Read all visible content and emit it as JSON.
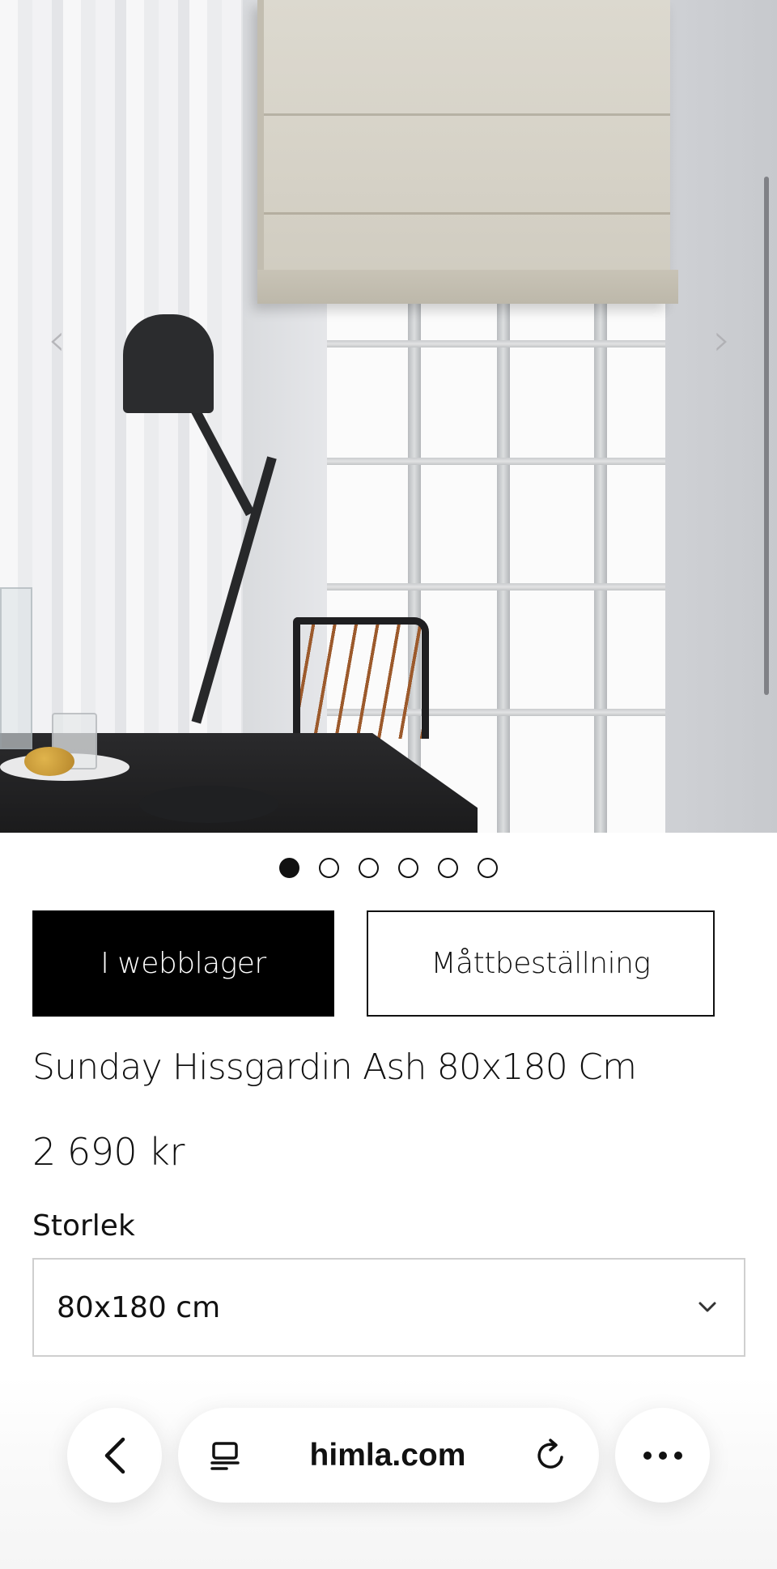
{
  "hero": {
    "prev_glyph": "‹",
    "next_glyph": "›",
    "slide_count": 6,
    "active_slide": 1
  },
  "mode_tabs": {
    "in_stock_label": "I webblager",
    "made_to_measure_label": "Måttbeställning"
  },
  "product": {
    "title": "Sunday Hissgardin Ash 80x180 Cm",
    "price": "2 690 kr"
  },
  "size": {
    "label": "Storlek",
    "selected": "80x180 cm"
  },
  "browser": {
    "url": "himla.com",
    "more_glyph": "•••"
  },
  "colors": {
    "accent": "#000000",
    "text": "#111111",
    "border": "#cfcfcf"
  }
}
